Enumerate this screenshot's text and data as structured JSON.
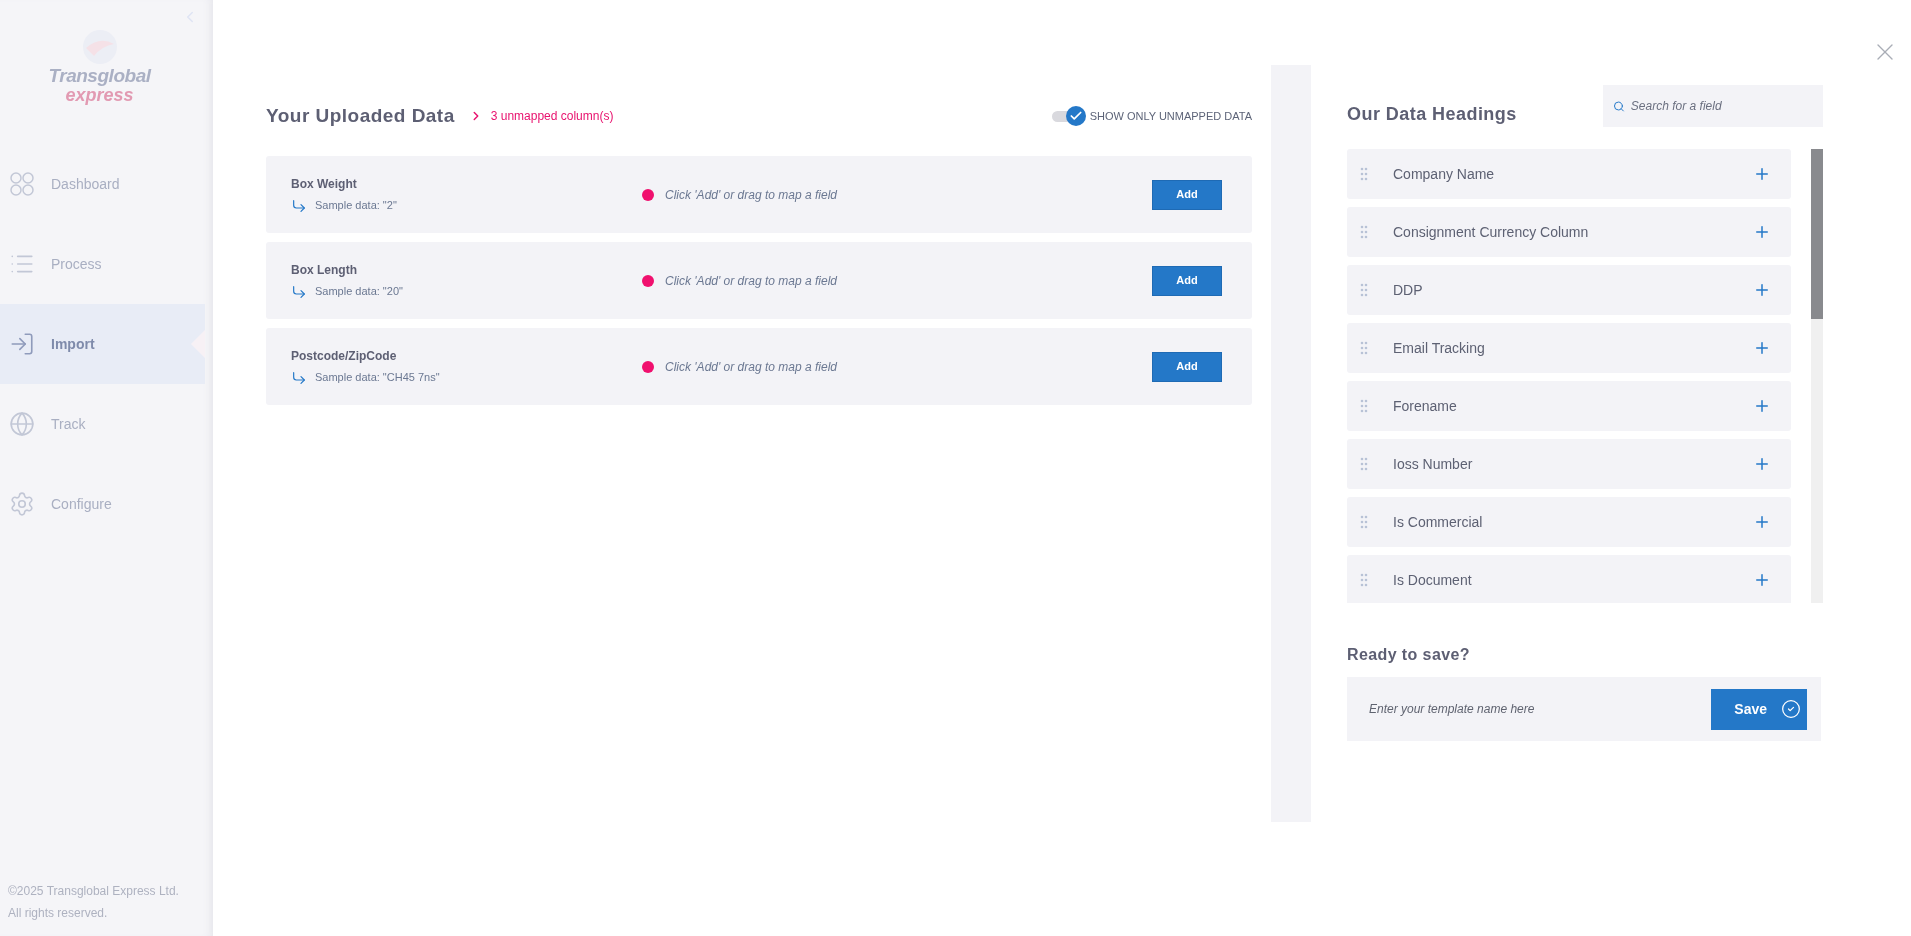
{
  "sidebar": {
    "logo": {
      "line_1": "Transglobal",
      "line_2": "express"
    },
    "items": [
      {
        "label": "Dashboard",
        "kind": "grid",
        "selected": false
      },
      {
        "label": "Process",
        "kind": "list",
        "selected": false
      },
      {
        "label": "Import",
        "kind": "import",
        "selected": true
      },
      {
        "label": "Track",
        "kind": "globe",
        "selected": false
      },
      {
        "label": "Configure",
        "kind": "gears",
        "selected": false
      }
    ],
    "footer": [
      "©2025 Transglobal Express Ltd.",
      "All rights reserved."
    ]
  },
  "uploaded": {
    "title": "Your Uploaded Data",
    "unmapped": "3 unmapped column(s)",
    "toggle": {
      "label": "SHOW ONLY UNMAPPED DATA",
      "on": true
    },
    "rows": [
      {
        "name": "Box Weight",
        "sample": "Sample data: \"2\"",
        "hint": "Click 'Add' or drag to map a field",
        "button": "Add"
      },
      {
        "name": "Box Length",
        "sample": "Sample data: \"20\"",
        "hint": "Click 'Add' or drag to map a field",
        "button": "Add"
      },
      {
        "name": "Postcode/ZipCode",
        "sample": "Sample data: \"CH45 7ns\"",
        "hint": "Click 'Add' or drag to map a field",
        "button": "Add"
      }
    ]
  },
  "headings": {
    "title": "Our Data Headings",
    "search": {
      "placeholder": "Search for a field"
    },
    "items": [
      "Company Name",
      "Consignment Currency Column",
      "DDP",
      "Email Tracking",
      "Forename",
      "Ioss Number",
      "Is Commercial",
      "Is Document"
    ]
  },
  "save": {
    "title": "Ready to save?",
    "placeholder": "Enter your template name here",
    "button": "Save"
  }
}
